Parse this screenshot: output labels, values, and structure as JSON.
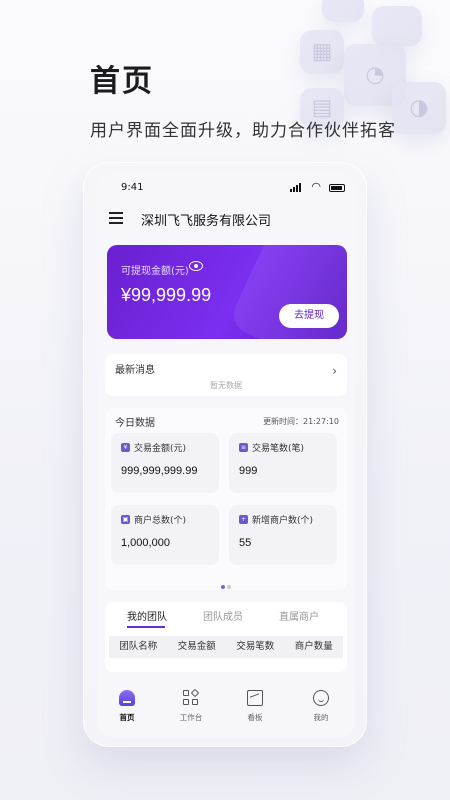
{
  "promo": {
    "title": "首页",
    "subtitle": "用户界面全面升级，助力合作伙伴拓客"
  },
  "status_bar": {
    "time": "9:41"
  },
  "header": {
    "company": "深圳飞飞服务有限公司",
    "menu_icon": "menu-icon"
  },
  "balance": {
    "label": "可提现金额(元)",
    "amount": "¥99,999.99",
    "withdraw_label": "去提现",
    "gradient_start": "#6a1fd0",
    "gradient_end": "#5a18c6"
  },
  "news": {
    "title": "最新消息",
    "empty": "暂无数据"
  },
  "today": {
    "title": "今日数据",
    "updated": "更新时间：21:27:10",
    "stats": [
      {
        "label": "交易金额(元)",
        "value": "999,999,999.99",
        "icon": "yuan-icon"
      },
      {
        "label": "交易笔数(笔)",
        "value": "999",
        "icon": "list-icon"
      },
      {
        "label": "商户总数(个)",
        "value": "1,000,000",
        "icon": "merchant-icon"
      },
      {
        "label": "新增商户数(个)",
        "value": "55",
        "icon": "new-merchant-icon"
      }
    ]
  },
  "team": {
    "tabs": [
      "我的团队",
      "团队成员",
      "直属商户"
    ],
    "active_tab": 0,
    "columns": [
      "团队名称",
      "交易金额",
      "交易笔数",
      "商户数量"
    ]
  },
  "nav": {
    "items": [
      {
        "label": "首页",
        "icon": "home-icon"
      },
      {
        "label": "工作台",
        "icon": "workbench-icon"
      },
      {
        "label": "看板",
        "icon": "board-icon"
      },
      {
        "label": "我的",
        "icon": "profile-icon"
      }
    ],
    "active": 0
  },
  "colors": {
    "accent": "#6a2ee0",
    "background": "#f6f6fb"
  }
}
